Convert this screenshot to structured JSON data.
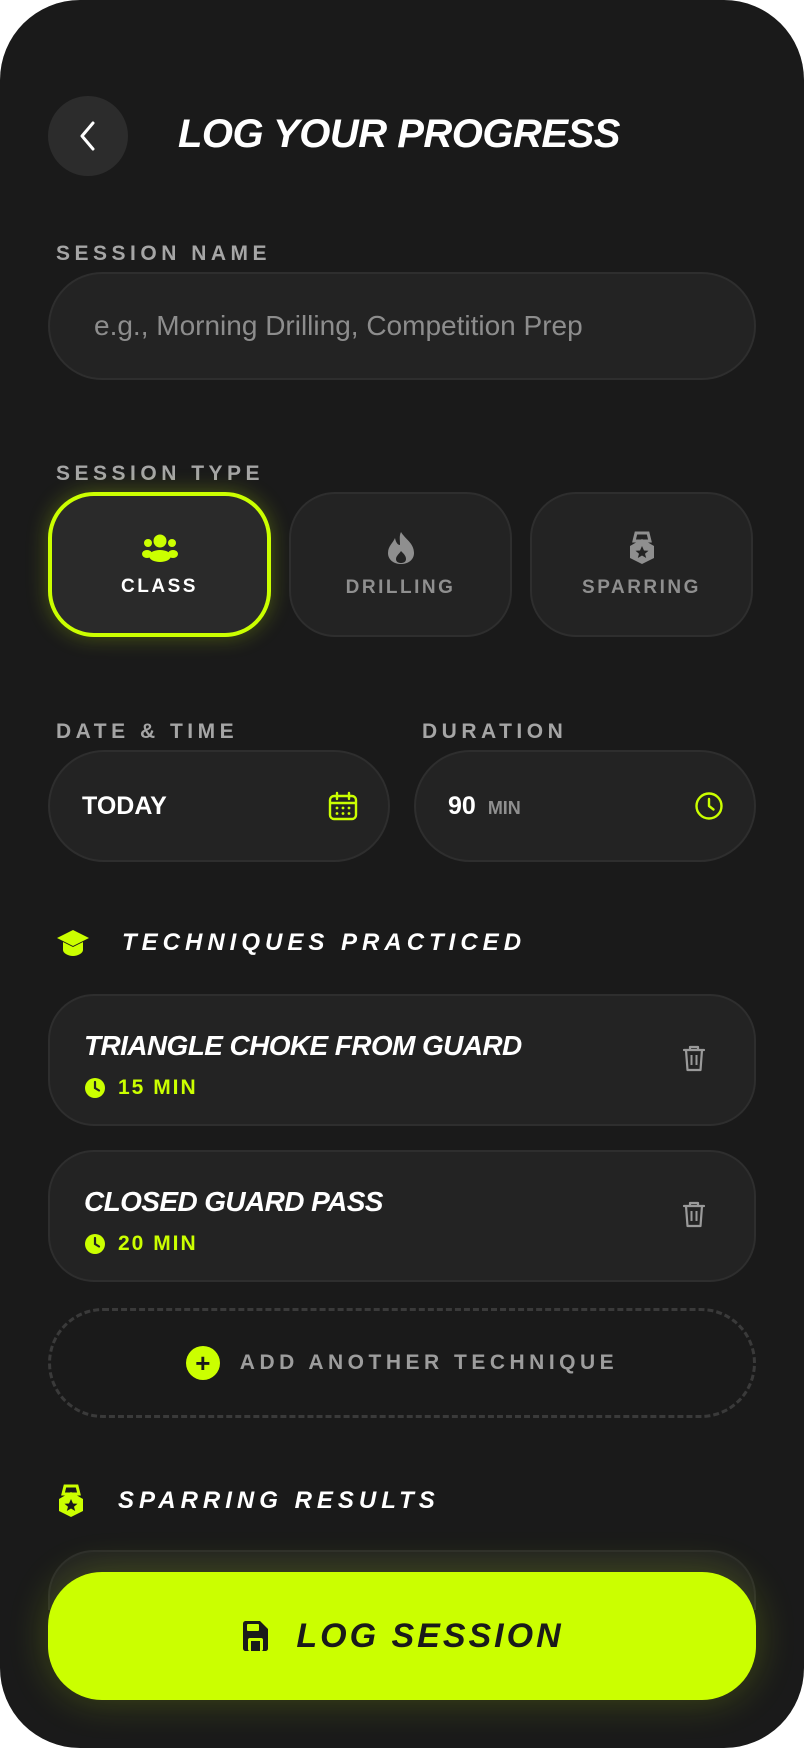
{
  "header": {
    "title": "LOG YOUR PROGRESS",
    "back_icon": "chevron-left-icon"
  },
  "session_name": {
    "label": "SESSION NAME",
    "placeholder": "e.g., Morning Drilling, Competition Prep",
    "value": ""
  },
  "session_type": {
    "label": "SESSION TYPE",
    "options": [
      {
        "label": "CLASS",
        "icon": "users-icon",
        "selected": true
      },
      {
        "label": "DRILLING",
        "icon": "fire-icon",
        "selected": false
      },
      {
        "label": "SPARRING",
        "icon": "medal-icon",
        "selected": false
      }
    ]
  },
  "date_time": {
    "label": "DATE & TIME",
    "value": "TODAY",
    "icon": "calendar-icon"
  },
  "duration": {
    "label": "DURATION",
    "value": "90",
    "unit": "MIN",
    "icon": "clock-icon"
  },
  "techniques": {
    "title": "TECHNIQUES PRACTICED",
    "icon": "graduation-cap-icon",
    "items": [
      {
        "name": "TRIANGLE CHOKE FROM GUARD",
        "duration": "15 MIN"
      },
      {
        "name": "CLOSED GUARD PASS",
        "duration": "20 MIN"
      }
    ],
    "add_label": "ADD ANOTHER TECHNIQUE"
  },
  "sparring": {
    "title": "SPARRING RESULTS",
    "icon": "medal-icon"
  },
  "footer": {
    "log_label": "LOG SESSION",
    "icon": "save-icon"
  },
  "colors": {
    "accent": "#cbff00",
    "background": "#1a1a1a",
    "card": "#232323"
  }
}
